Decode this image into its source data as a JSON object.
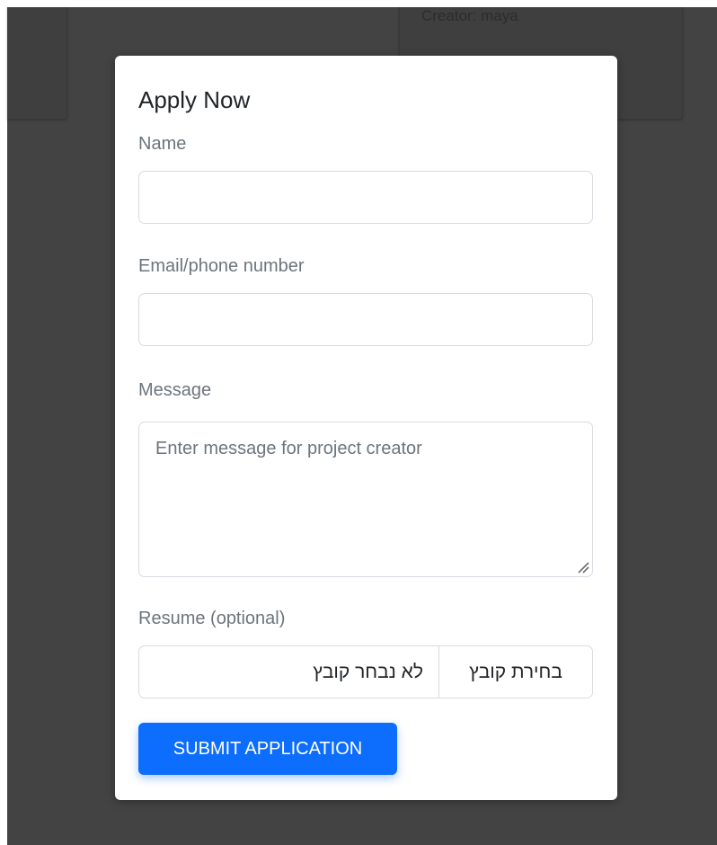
{
  "background": {
    "card_creator_text": "Creator: maya"
  },
  "modal": {
    "title": "Apply Now",
    "name_label": "Name",
    "name_value": "",
    "contact_label": "Email/phone number",
    "contact_value": "",
    "message_label": "Message",
    "message_placeholder": "Enter message for project creator",
    "resume_label": "Resume (optional)",
    "file_button_label": "בחירת קובץ",
    "file_status_text": "לא נבחר קובץ",
    "submit_label": "SUBMIT APPLICATION"
  },
  "colors": {
    "backdrop": "#434343",
    "primary": "#0d6efd",
    "label_text": "#6c757d",
    "border": "#d8dbe0"
  },
  "icons": {
    "textarea_resize": "resize-grip-icon"
  }
}
